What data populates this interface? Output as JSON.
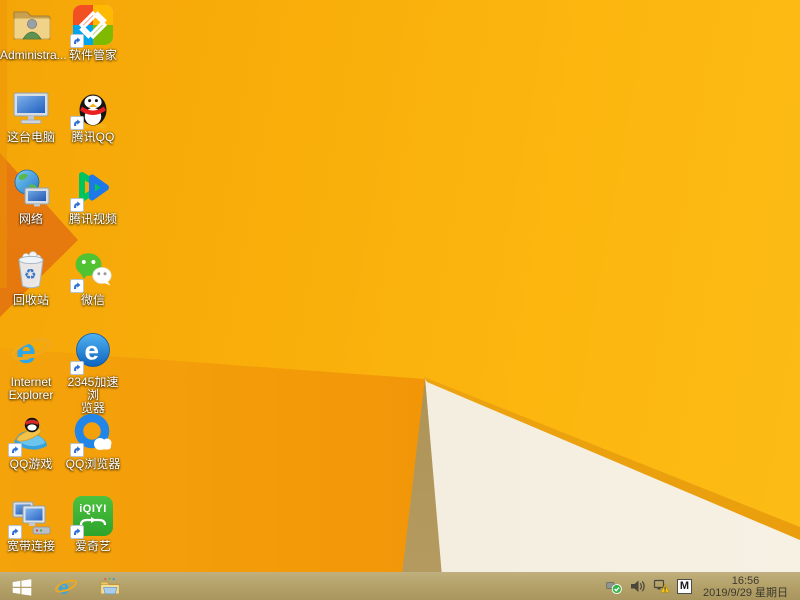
{
  "desktop": {
    "icons": [
      {
        "label": "Administra...",
        "name": "administrator-folder",
        "shortcut": false
      },
      {
        "label": "软件管家",
        "name": "software-manager",
        "shortcut": true
      },
      {
        "label": "这台电脑",
        "name": "this-pc",
        "shortcut": false
      },
      {
        "label": "腾讯QQ",
        "name": "tencent-qq",
        "shortcut": true
      },
      {
        "label": "网络",
        "name": "network",
        "shortcut": false
      },
      {
        "label": "腾讯视频",
        "name": "tencent-video",
        "shortcut": true
      },
      {
        "label": "回收站",
        "name": "recycle-bin",
        "shortcut": false
      },
      {
        "label": "微信",
        "name": "wechat",
        "shortcut": true
      },
      {
        "label": "Internet\nExplorer",
        "name": "internet-explorer",
        "shortcut": false
      },
      {
        "label": "2345加速浏\n览器",
        "name": "2345-browser",
        "shortcut": true
      },
      {
        "label": "QQ游戏",
        "name": "qq-game",
        "shortcut": true
      },
      {
        "label": "QQ浏览器",
        "name": "qq-browser",
        "shortcut": true
      },
      {
        "label": "宽带连接",
        "name": "broadband-connection",
        "shortcut": true
      },
      {
        "label": "爱奇艺",
        "name": "iqiyi",
        "shortcut": true
      }
    ],
    "iqiyi_word": "iQIYI"
  },
  "taskbar": {
    "buttons": [
      "start",
      "internet-explorer",
      "file-explorer"
    ],
    "tray": {
      "icons": [
        "safely-remove-hardware",
        "volume",
        "network-warning"
      ],
      "input_indicator": "M",
      "clock": {
        "time": "16:56",
        "date": "2019/9/29 星期日"
      }
    }
  },
  "wallpaper": {
    "base_amber": "#fbb30e",
    "lower_left_orange": "#f29408",
    "dark_wedge_orange": "#e4760c",
    "fold_olive": "#ab9053",
    "fold_cream": "#f4eee0",
    "edge_stripe": "#e89c0c",
    "taskbar_tan": "#b3a169"
  }
}
